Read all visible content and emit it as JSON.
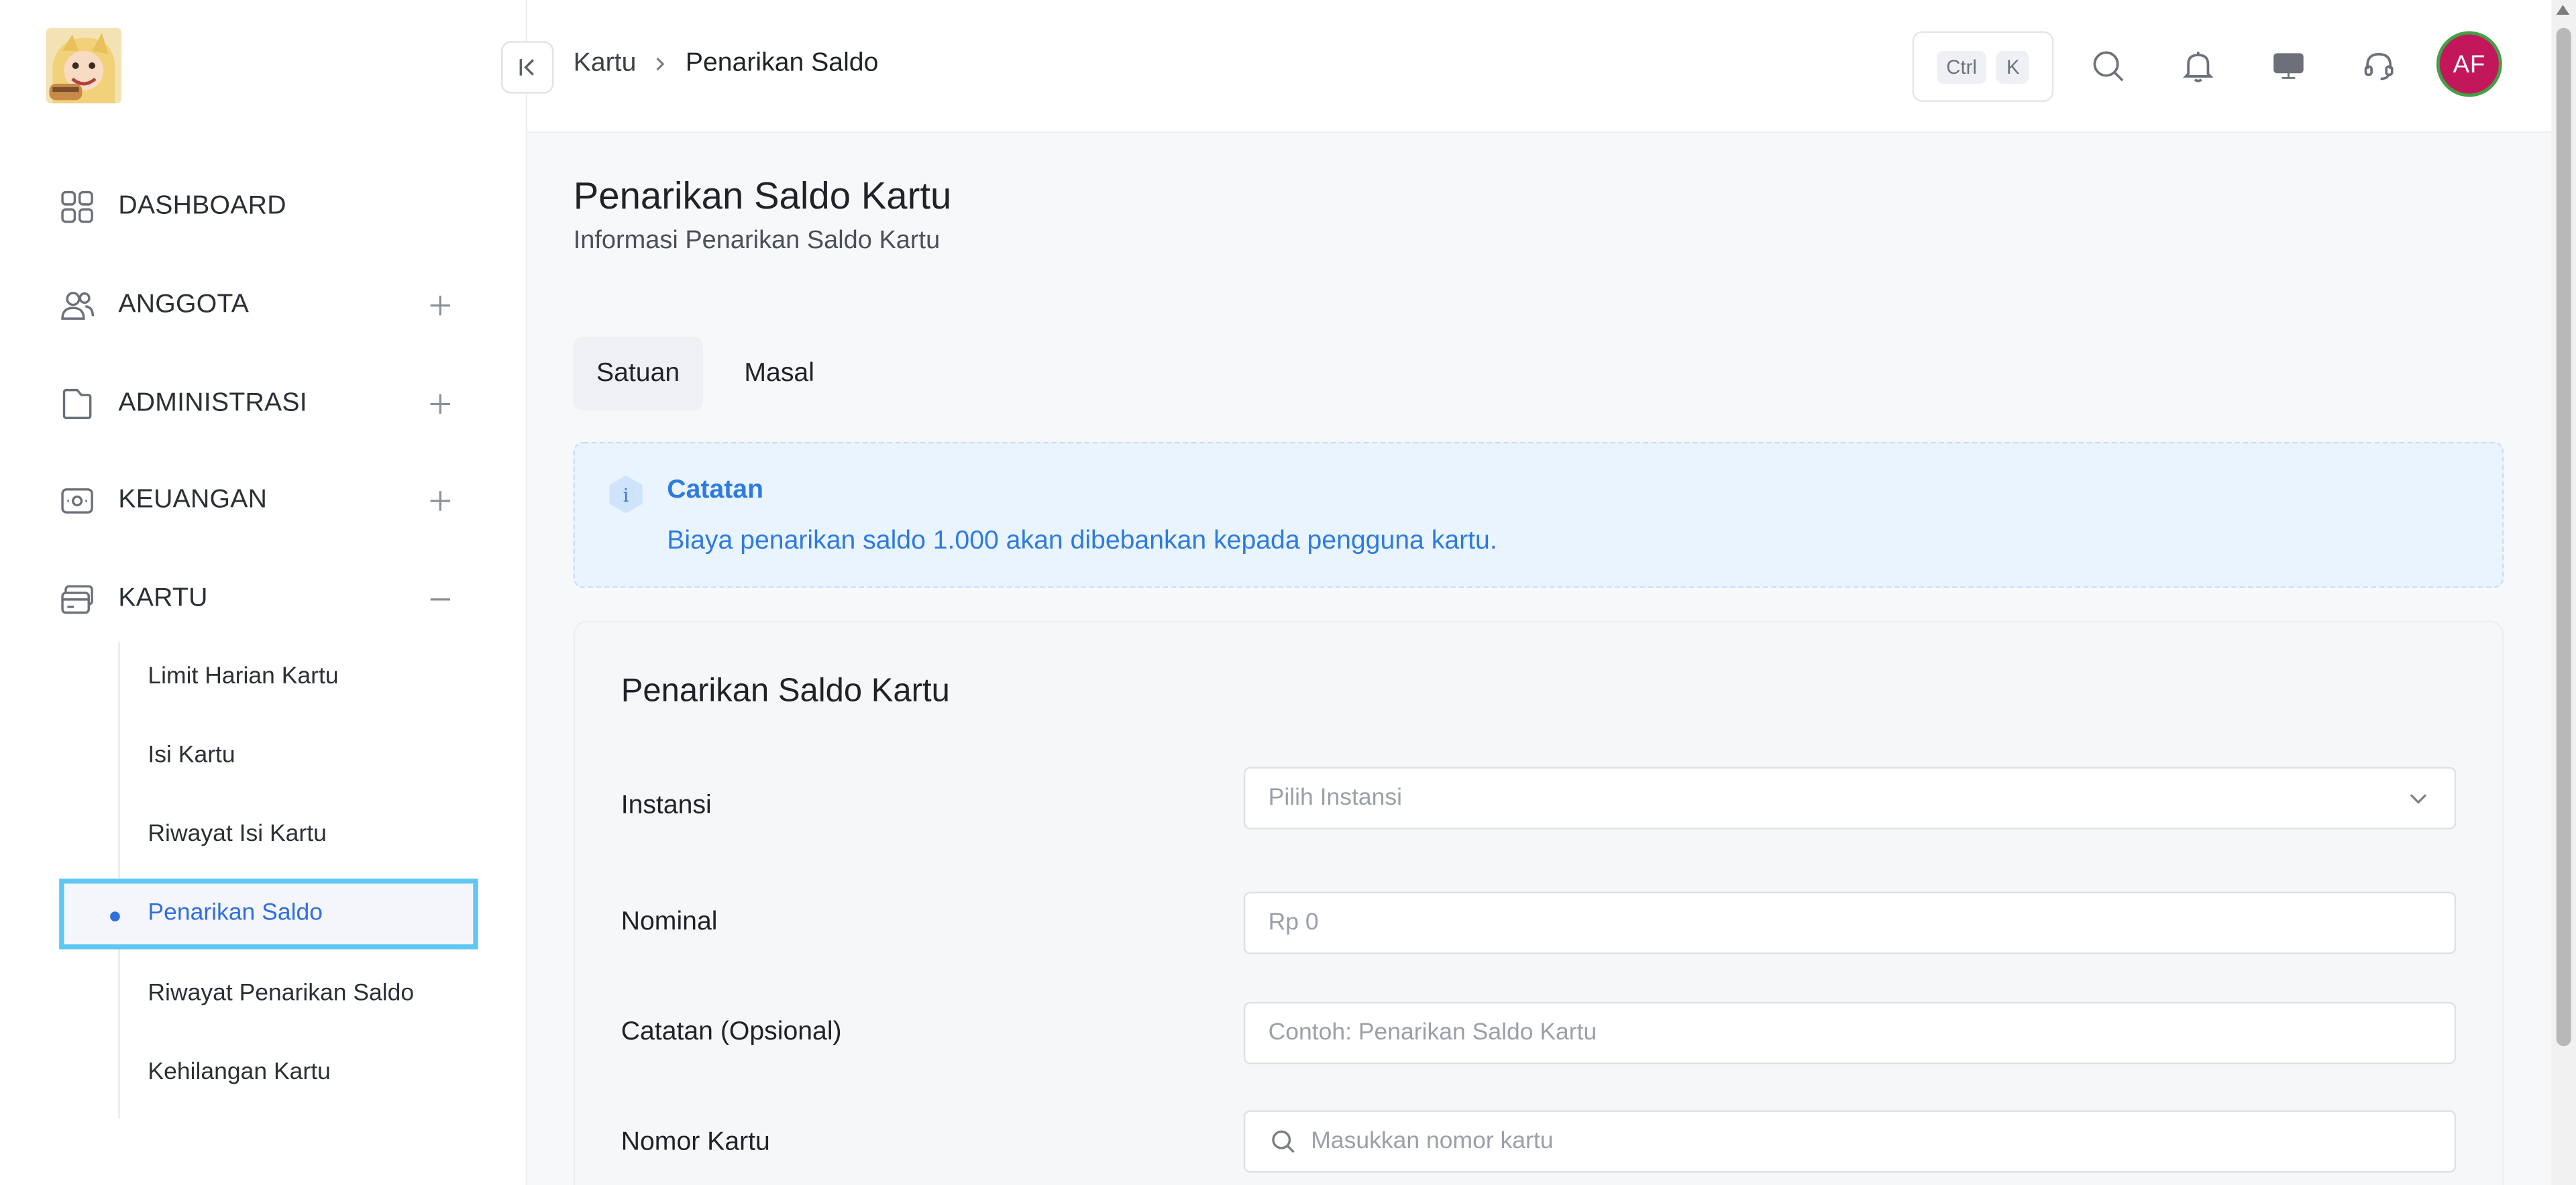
{
  "sidebar": {
    "items": [
      {
        "label": "DASHBOARD",
        "icon": "dashboard-grid-icon"
      },
      {
        "label": "ANGGOTA",
        "icon": "users-icon",
        "toggle": "plus"
      },
      {
        "label": "ADMINISTRASI",
        "icon": "folder-icon",
        "toggle": "plus"
      },
      {
        "label": "KEUANGAN",
        "icon": "cash-icon",
        "toggle": "plus"
      },
      {
        "label": "KARTU",
        "icon": "card-icon",
        "toggle": "minus"
      }
    ],
    "sub_items": [
      {
        "label": "Limit Harian Kartu"
      },
      {
        "label": "Isi Kartu"
      },
      {
        "label": "Riwayat Isi Kartu"
      },
      {
        "label": "Penarikan Saldo",
        "active": true
      },
      {
        "label": "Riwayat Penarikan Saldo"
      },
      {
        "label": "Kehilangan Kartu"
      }
    ]
  },
  "header": {
    "breadcrumb": [
      "Kartu",
      "Penarikan Saldo"
    ],
    "shortcut_keys": [
      "Ctrl",
      "K"
    ],
    "avatar_initials": "AF",
    "icons": [
      "search-icon",
      "bell-icon",
      "monitor-icon",
      "headset-icon"
    ]
  },
  "main": {
    "title": "Penarikan Saldo Kartu",
    "subtitle": "Informasi Penarikan Saldo Kartu",
    "tabs": [
      {
        "label": "Satuan",
        "active": true
      },
      {
        "label": "Masal",
        "active": false
      }
    ],
    "alert": {
      "title": "Catatan",
      "text": "Biaya penarikan saldo 1.000 akan dibebankan kepada pengguna kartu."
    },
    "form": {
      "title": "Penarikan Saldo Kartu",
      "fields": [
        {
          "label": "Instansi",
          "placeholder": "Pilih Instansi",
          "type": "select"
        },
        {
          "label": "Nominal",
          "placeholder": "Rp 0",
          "type": "text"
        },
        {
          "label": "Catatan (Opsional)",
          "placeholder": "Contoh: Penarikan Saldo Kartu",
          "type": "text"
        },
        {
          "label": "Nomor Kartu",
          "placeholder": "Masukkan nomor kartu",
          "type": "search"
        }
      ]
    }
  },
  "colors": {
    "accent": "#2f6fe0",
    "alert_text": "#2d7be0",
    "alert_bg": "#eaf4fe",
    "avatar_bg": "#c2185b",
    "avatar_ring": "#43a047",
    "active_outline": "#5ec8f2"
  }
}
